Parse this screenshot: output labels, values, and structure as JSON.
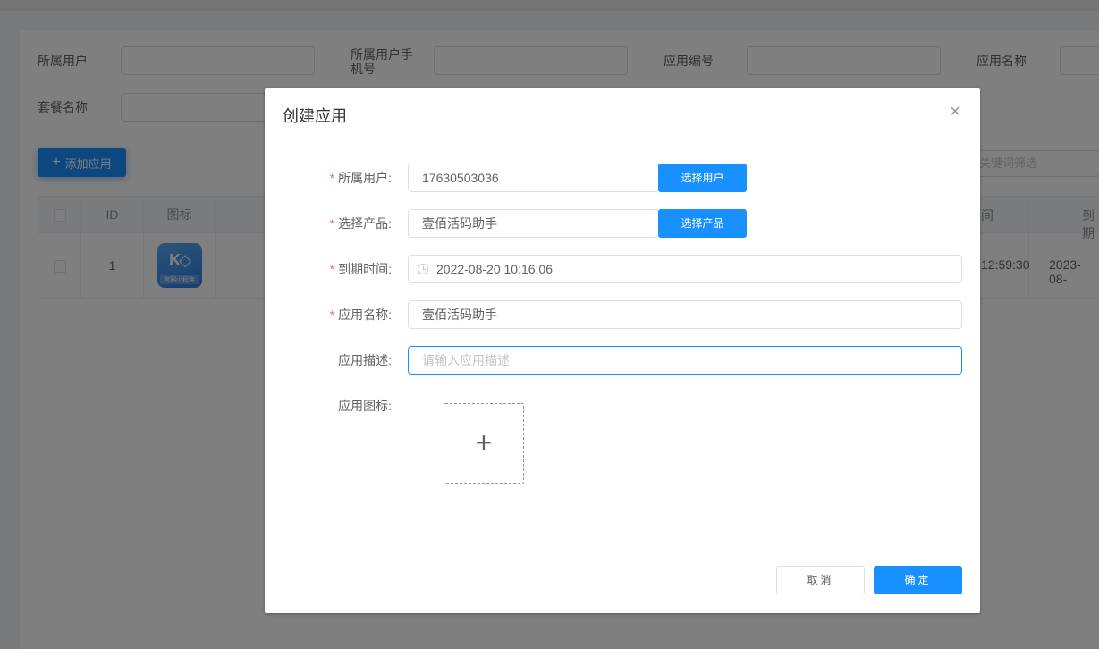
{
  "filters": {
    "owner_user_label": "所属用户",
    "owner_phone_label_line1": "所属用户手",
    "owner_phone_label_line2": "机号",
    "app_code_label": "应用编号",
    "app_name_label": "应用名称",
    "package_name_label": "套餐名称"
  },
  "toolbar": {
    "add_app_label": "添加应用",
    "keyword_placeholder": "关键词筛选"
  },
  "table": {
    "headers": [
      "ID",
      "图标"
    ],
    "right_headers": [
      "间",
      "到期"
    ],
    "rows": [
      {
        "id": "1",
        "icon_caption": "官网小程序",
        "time": "12:59:30",
        "expire": "2023-08-"
      }
    ]
  },
  "modal": {
    "title": "创建应用",
    "fields": {
      "owner_user": {
        "label": "所属用户:",
        "value": "17630503036",
        "button": "选择用户",
        "required": true
      },
      "product": {
        "label": "选择产品:",
        "value": "壹佰活码助手",
        "button": "选择产品",
        "required": true
      },
      "expire_time": {
        "label": "到期时间:",
        "value": "2022-08-20 10:16:06",
        "required": true
      },
      "app_name": {
        "label": "应用名称:",
        "value": "壹佰活码助手",
        "required": true
      },
      "app_desc": {
        "label": "应用描述:",
        "placeholder": "请输入应用描述",
        "required": false
      },
      "app_icon": {
        "label": "应用图标:",
        "required": false
      }
    },
    "cancel_label": "取消",
    "ok_label": "确定"
  },
  "icons": {
    "close": "close-icon",
    "clock": "clock-icon",
    "upload": "plus-icon",
    "add": "plus-icon"
  },
  "colors": {
    "primary": "#1890ff",
    "required": "#f56c6c"
  }
}
